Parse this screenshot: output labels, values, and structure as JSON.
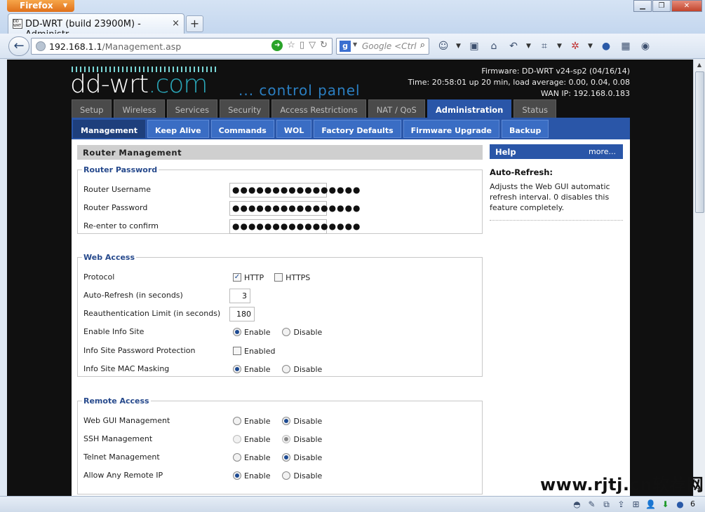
{
  "browser": {
    "menu_button": "Firefox",
    "tab_title": "DD-WRT (build 23900M) - Administr...",
    "tab_favicon": "DD WRT",
    "url_host": "192.168.1.1",
    "url_path": "/Management.asp",
    "search_placeholder": "Google <Ctrl",
    "status_count": "6"
  },
  "header": {
    "logo_text": "dd-wrt",
    "logo_suffix": ".com",
    "control_panel": "... control panel",
    "firmware": "Firmware: DD-WRT v24-sp2 (04/16/14)",
    "time": "Time: 20:58:01 up 20 min, load average: 0.00, 0.04, 0.08",
    "wan_ip": "WAN IP: 192.168.0.183"
  },
  "main_tabs": [
    "Setup",
    "Wireless",
    "Services",
    "Security",
    "Access Restrictions",
    "NAT / QoS",
    "Administration",
    "Status"
  ],
  "sub_tabs": [
    "Management",
    "Keep Alive",
    "Commands",
    "WOL",
    "Factory Defaults",
    "Firmware Upgrade",
    "Backup"
  ],
  "page_title": "Router Management",
  "router_password": {
    "legend": "Router Password",
    "username_label": "Router Username",
    "username_value": "●●●●●●●●●●●●●●●●",
    "password_label": "Router Password",
    "password_value": "●●●●●●●●●●●●●●●●",
    "confirm_label": "Re-enter to confirm",
    "confirm_value": "●●●●●●●●●●●●●●●●"
  },
  "web_access": {
    "legend": "Web Access",
    "protocol_label": "Protocol",
    "http": "HTTP",
    "https": "HTTPS",
    "refresh_label": "Auto-Refresh (in seconds)",
    "refresh_value": "3",
    "reauth_label": "Reauthentication Limit (in seconds)",
    "reauth_value": "180",
    "info_site_label": "Enable Info Site",
    "info_pw_label": "Info Site Password Protection",
    "enabled": "Enabled",
    "info_mac_label": "Info Site MAC Masking"
  },
  "remote_access": {
    "legend": "Remote Access",
    "gui_label": "Web GUI Management",
    "ssh_label": "SSH Management",
    "telnet_label": "Telnet Management",
    "any_ip_label": "Allow Any Remote IP"
  },
  "radio": {
    "enable": "Enable",
    "disable": "Disable"
  },
  "help": {
    "title": "Help",
    "more": "more...",
    "topic": "Auto-Refresh:",
    "text": "Adjusts the Web GUI automatic refresh interval. 0 disables this feature completely."
  },
  "watermark": "www.rjtj.cn软荐网"
}
